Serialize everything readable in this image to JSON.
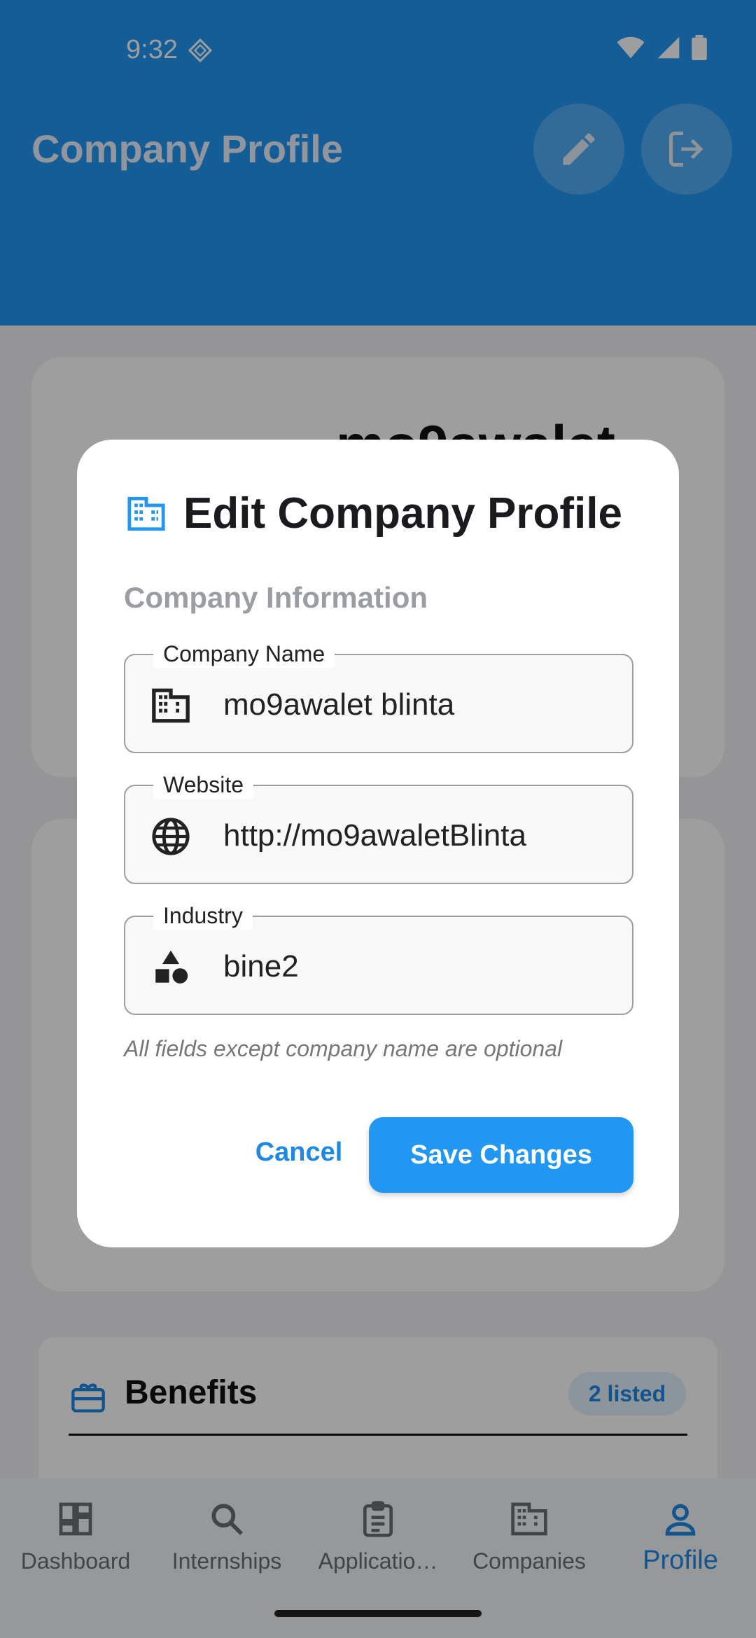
{
  "status": {
    "time": "9:32"
  },
  "appbar": {
    "title": "Company Profile"
  },
  "background": {
    "company_name_partial": "mo9awalet",
    "benefits": {
      "title": "Benefits",
      "badge": "2 listed"
    }
  },
  "nav": {
    "items": [
      {
        "label": "Dashboard",
        "icon": "dashboard-icon"
      },
      {
        "label": "Internships",
        "icon": "search-icon"
      },
      {
        "label": "Applicatio…",
        "icon": "clipboard-icon"
      },
      {
        "label": "Companies",
        "icon": "building-icon"
      },
      {
        "label": "Profile",
        "icon": "person-icon",
        "active": true
      }
    ]
  },
  "dialog": {
    "title": "Edit Company Profile",
    "section": "Company Information",
    "fields": {
      "company_name": {
        "label": "Company Name",
        "value": "mo9awalet blinta"
      },
      "website": {
        "label": "Website",
        "value": "http://mo9awaletBlinta"
      },
      "industry": {
        "label": "Industry",
        "value": "bine2"
      }
    },
    "hint": "All fields except company name are optional",
    "cancel_label": "Cancel",
    "save_label": "Save Changes"
  },
  "colors": {
    "primary": "#2196f3",
    "accent_text": "#1e88e5"
  }
}
